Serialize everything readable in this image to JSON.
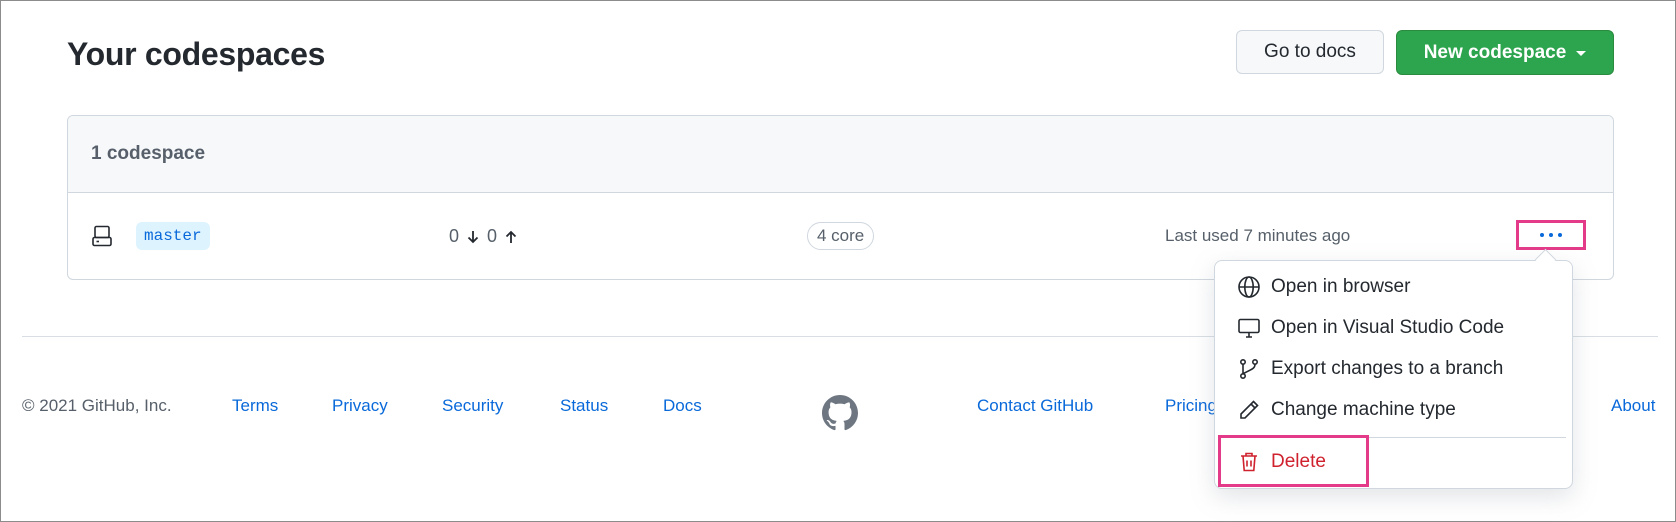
{
  "page": {
    "title": "Your codespaces"
  },
  "header": {
    "docs_button": "Go to docs",
    "new_button": "New codespace"
  },
  "list": {
    "count_label": "1 codespace",
    "rows": [
      {
        "branch": "master",
        "behind": "0",
        "ahead": "0",
        "machine": "4 core",
        "last_used": "Last used 7 minutes ago"
      }
    ]
  },
  "menu": {
    "items": [
      {
        "label": "Open in browser",
        "icon": "globe-icon"
      },
      {
        "label": "Open in Visual Studio Code",
        "icon": "desktop-icon"
      },
      {
        "label": "Export changes to a branch",
        "icon": "git-branch-icon"
      },
      {
        "label": "Change machine type",
        "icon": "pencil-icon"
      }
    ],
    "danger": {
      "label": "Delete",
      "icon": "trash-icon",
      "color": "#cf222e"
    }
  },
  "footer": {
    "copyright": "© 2021 GitHub, Inc.",
    "links_left": [
      "Terms",
      "Privacy",
      "Security",
      "Status",
      "Docs"
    ],
    "links_right": [
      "Contact GitHub",
      "Pricing",
      "About"
    ]
  },
  "colors": {
    "primary_green": "#2da44e",
    "link_blue": "#0969da",
    "highlight_pink": "#e33b8a"
  }
}
